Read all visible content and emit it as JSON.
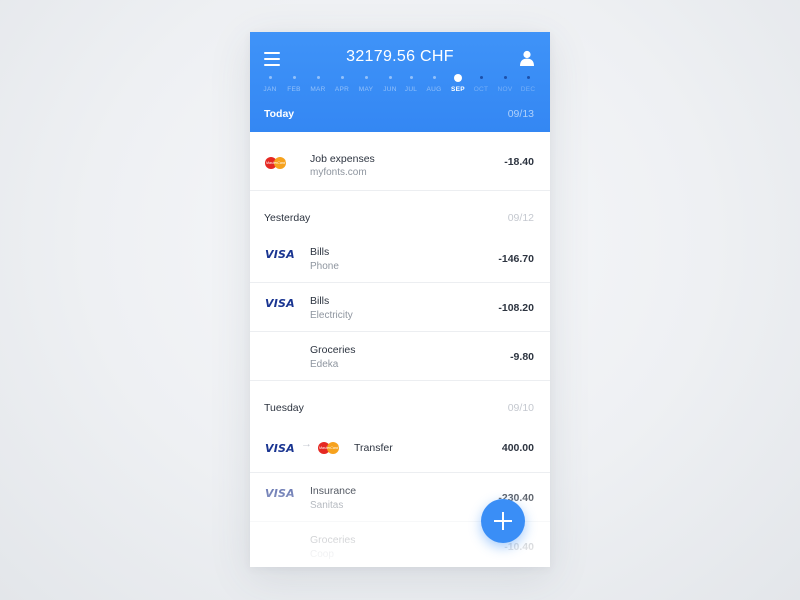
{
  "header": {
    "balance": "32179.56 CHF",
    "icons": {
      "menu": "hamburger-menu-icon",
      "user": "user-icon"
    },
    "months": [
      {
        "label": "JAN",
        "state": "past"
      },
      {
        "label": "FEB",
        "state": "past"
      },
      {
        "label": "MAR",
        "state": "past"
      },
      {
        "label": "APR",
        "state": "past"
      },
      {
        "label": "MAY",
        "state": "past"
      },
      {
        "label": "JUN",
        "state": "past"
      },
      {
        "label": "JUL",
        "state": "past"
      },
      {
        "label": "AUG",
        "state": "past"
      },
      {
        "label": "SEP",
        "state": "active"
      },
      {
        "label": "OCT",
        "state": "future"
      },
      {
        "label": "NOV",
        "state": "future"
      },
      {
        "label": "DEC",
        "state": "future"
      }
    ],
    "day": "Today",
    "date": "09/13"
  },
  "groups": {
    "today": {
      "rows": [
        {
          "card": "mastercard",
          "title": "Job expenses",
          "sub": "myfonts.com",
          "amount": "-18.40"
        }
      ]
    },
    "yesterday": {
      "day": "Yesterday",
      "date": "09/12",
      "rows": [
        {
          "card": "visa",
          "card_label": "VISA",
          "title": "Bills",
          "sub": "Phone",
          "amount": "-146.70"
        },
        {
          "card": "visa",
          "card_label": "VISA",
          "title": "Bills",
          "sub": "Electricity",
          "amount": "-108.20"
        },
        {
          "card": "none",
          "title": "Groceries",
          "sub": "Edeka",
          "amount": "-9.80"
        }
      ]
    },
    "tuesday": {
      "day": "Tuesday",
      "date": "09/10",
      "transfer": {
        "from_label": "VISA",
        "to": "mastercard",
        "title": "Transfer",
        "amount": "400.00"
      },
      "rows": [
        {
          "card": "visa",
          "card_label": "VISA",
          "title": "Insurance",
          "sub": "Sanitas",
          "amount": "-230.40"
        },
        {
          "card": "none",
          "title": "Groceries",
          "sub": "Coop",
          "amount": "-10.40"
        }
      ]
    }
  },
  "fab": {
    "icon": "plus-icon"
  },
  "colors": {
    "accent": "#3a8ef6",
    "visa": "#1a3591",
    "mastercard_red": "#e52822",
    "mastercard_yellow": "#f6a21e",
    "text": "#2d3440",
    "muted": "#8e959f"
  }
}
